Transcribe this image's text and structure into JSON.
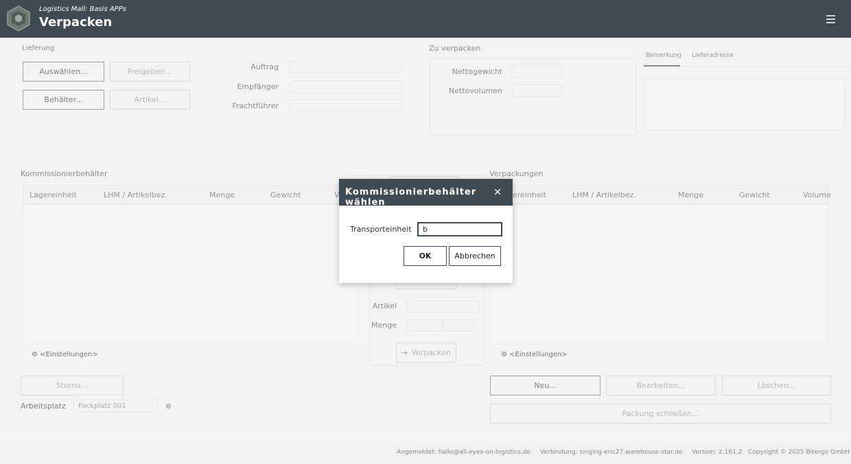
{
  "header": {
    "subtitle": "Logistics Mall: Basis APPs",
    "title": "Verpacken"
  },
  "lieferung": {
    "label": "Lieferung",
    "buttons": {
      "auswaehlen": "Auswählen...",
      "freigeben": "Freigeben...",
      "behaelter": "Behälter...",
      "artikel": "Artikel..."
    },
    "fields": {
      "auftrag": "Auftrag",
      "empfaenger": "Empfänger",
      "frachtfuehrer": "Frachtführer"
    }
  },
  "zu_verpacken": {
    "label": "Zu verpacken",
    "nettogewicht": "Nettogewicht",
    "nettovolumen": "Nettovolumen"
  },
  "side_tabs": {
    "bemerkung": "Bemerkung",
    "lieferadresse": "Lieferadresse"
  },
  "kommissionierbehaelter": {
    "label": "Kommissionierbehälter",
    "columns": [
      "Lagereinheit",
      "LHM / Artikelbez.",
      "Menge",
      "Gewicht",
      "V"
    ],
    "settings": "<Einstellungen>",
    "storno": "Storno...",
    "arbeitsplatz_label": "Arbeitsplatz",
    "arbeitsplatz_value": "Packplatz 001"
  },
  "center": {
    "artikel": "Artikel",
    "menge": "Menge",
    "verpacken": "Verpacken"
  },
  "verpackungen": {
    "label": "Verpackungen",
    "columns": [
      "Lagereinheit",
      "LHM / Artikelbez.",
      "Menge",
      "Gewicht",
      "Volume"
    ],
    "settings": "<Einstellungen>",
    "neu": "Neu...",
    "bearbeiten": "Bearbeiten...",
    "loeschen": "Löschen...",
    "packung_schliessen": "Packung schließen..."
  },
  "footer": {
    "angemeldet": "Angemeldet: hallo@all-eyes-on-logistics.de",
    "verbindung": "Verbindung: singing-eric27.warehouse-star.de",
    "version": "Version: 2.161.2",
    "copyright": "Copyright © 2025 Bitergo GmbH"
  },
  "dialog": {
    "title": "Kommissionierbehälter wählen",
    "field_label": "Transporteinheit",
    "field_value": "b",
    "ok": "OK",
    "cancel": "Abbrechen"
  },
  "colors": {
    "header_bg": "#404a52",
    "page_bg": "#f4f4f4"
  }
}
